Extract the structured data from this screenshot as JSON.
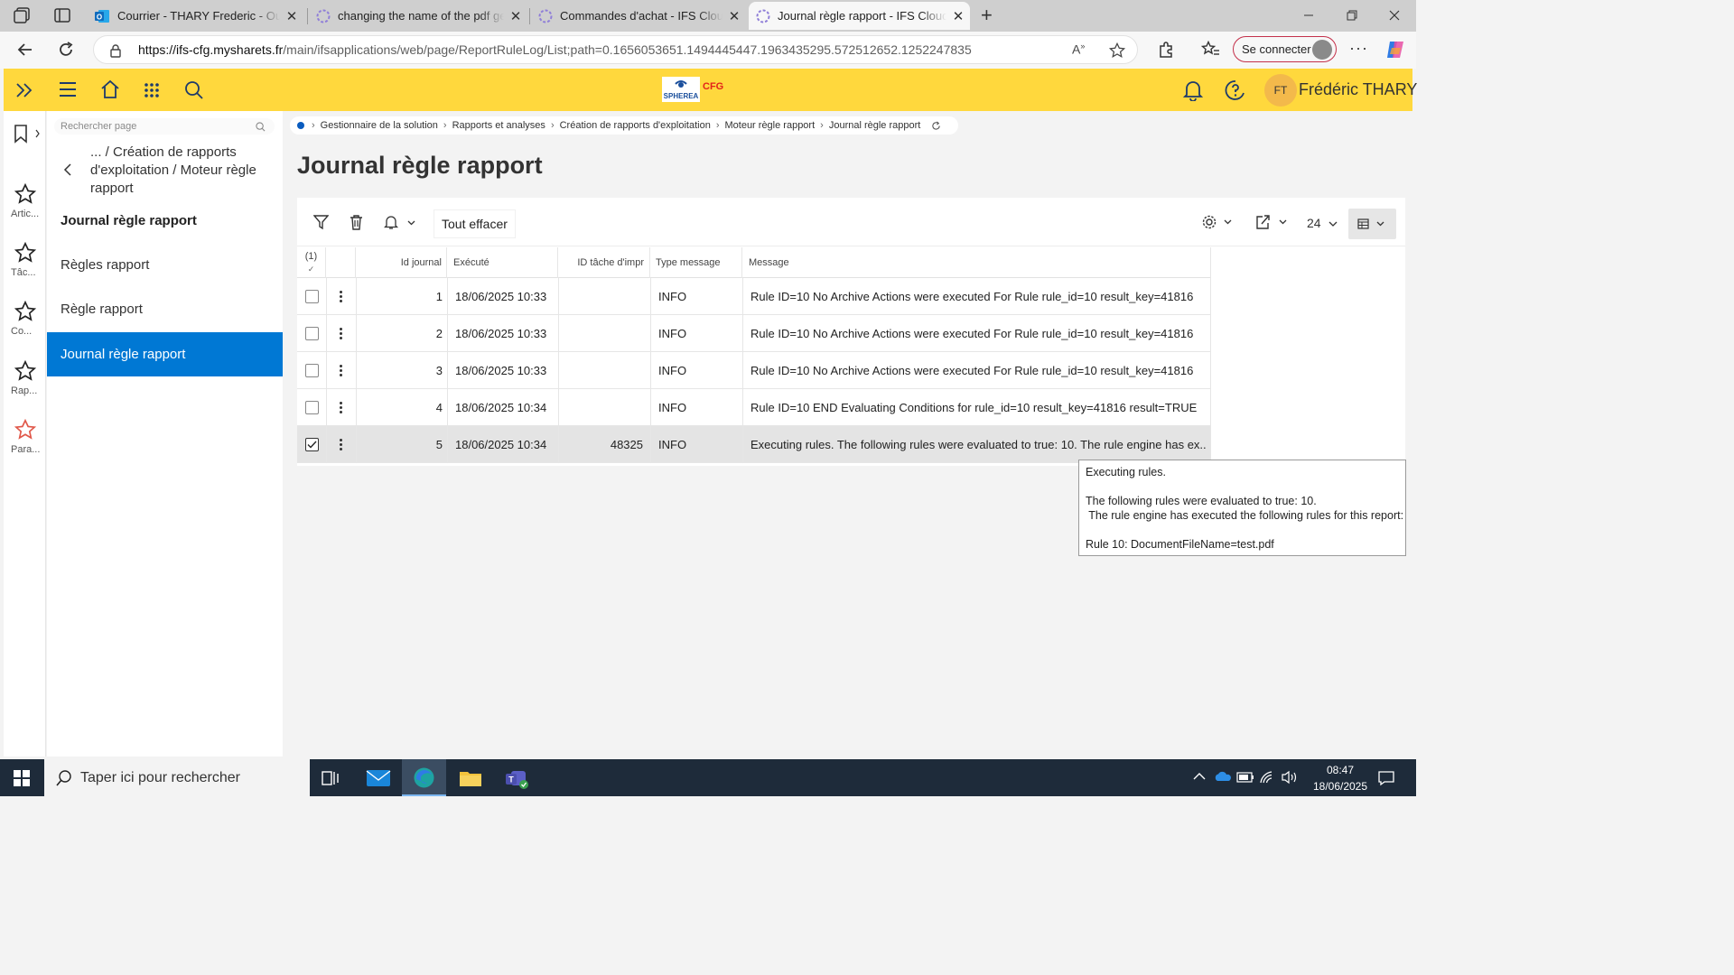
{
  "browser": {
    "tabs": [
      {
        "title": "Courrier - THARY Frederic - Outlook",
        "active": false
      },
      {
        "title": "changing the name of the pdf generated",
        "active": false
      },
      {
        "title": "Commandes d'achat - IFS Cloud f",
        "active": false
      },
      {
        "title": "Journal règle rapport - IFS Cloud f",
        "active": true
      }
    ],
    "url_host": "https://ifs-cfg.mysharets.fr",
    "url_path": "/main/ifsapplications/web/page/ReportRuleLog/List;path=0.1656053651.1494445447.1963435295.572512652.1252247835",
    "connect_label": "Se connecter"
  },
  "header": {
    "logo_text_1": "SPHEREA",
    "logo_text_2": "CFG",
    "user_initials": "FT",
    "user_name": "Frédéric THARY",
    "accent_color": "#ffd83d"
  },
  "favorites": [
    {
      "label": "Artic...",
      "icon": "star-icon"
    },
    {
      "label": "Tâc...",
      "icon": "star-icon"
    },
    {
      "label": "Co...",
      "icon": "star-icon"
    },
    {
      "label": "Rap...",
      "icon": "star-icon"
    },
    {
      "label": "Para...",
      "icon": "star-outline-icon"
    }
  ],
  "nav": {
    "search_placeholder": "Rechercher page",
    "back_path": "... / Création de rapports d'exploitation / Moteur règle rapport",
    "current_heading": "Journal règle rapport",
    "items": [
      {
        "label": "Règles rapport",
        "selected": false
      },
      {
        "label": "Règle rapport",
        "selected": false
      },
      {
        "label": "Journal règle rapport",
        "selected": true
      }
    ],
    "selected_color": "#0078d4"
  },
  "breadcrumb": [
    "Gestionnaire de la solution",
    "Rapports et analyses",
    "Création de rapports d'exploitation",
    "Moteur règle rapport",
    "Journal règle rapport"
  ],
  "page": {
    "title": "Journal règle rapport",
    "toolbar": {
      "clear_all": "Tout effacer",
      "page_size": "24"
    }
  },
  "table": {
    "selection_count": "(1)",
    "columns": [
      "Id journal",
      "Exécuté",
      "ID tâche d'impr",
      "Type message",
      "Message"
    ],
    "rows": [
      {
        "id": "1",
        "executed": "18/06/2025 10:33",
        "task": "",
        "type": "INFO",
        "message": "Rule ID=10 No Archive Actions were executed For Rule rule_id=10 result_key=41816",
        "checked": false
      },
      {
        "id": "2",
        "executed": "18/06/2025 10:33",
        "task": "",
        "type": "INFO",
        "message": "Rule ID=10 No Archive Actions were executed For Rule rule_id=10 result_key=41816",
        "checked": false
      },
      {
        "id": "3",
        "executed": "18/06/2025 10:33",
        "task": "",
        "type": "INFO",
        "message": "Rule ID=10 No Archive Actions were executed For Rule rule_id=10 result_key=41816",
        "checked": false
      },
      {
        "id": "4",
        "executed": "18/06/2025 10:34",
        "task": "",
        "type": "INFO",
        "message": "Rule ID=10 END Evaluating Conditions for rule_id=10 result_key=41816 result=TRUE",
        "checked": false
      },
      {
        "id": "5",
        "executed": "18/06/2025 10:34",
        "task": "48325",
        "type": "INFO",
        "message": "Executing rules. The following rules were evaluated to true: 10. The rule engine has ex...",
        "checked": true
      }
    ]
  },
  "tooltip": {
    "text": "Executing rules.\n\nThe following rules were evaluated to true: 10.\n The rule engine has executed the following rules for this report:\n\nRule 10: DocumentFileName=test.pdf"
  },
  "taskbar": {
    "search_placeholder": "Taper ici pour rechercher",
    "time": "08:47",
    "date": "18/06/2025"
  }
}
